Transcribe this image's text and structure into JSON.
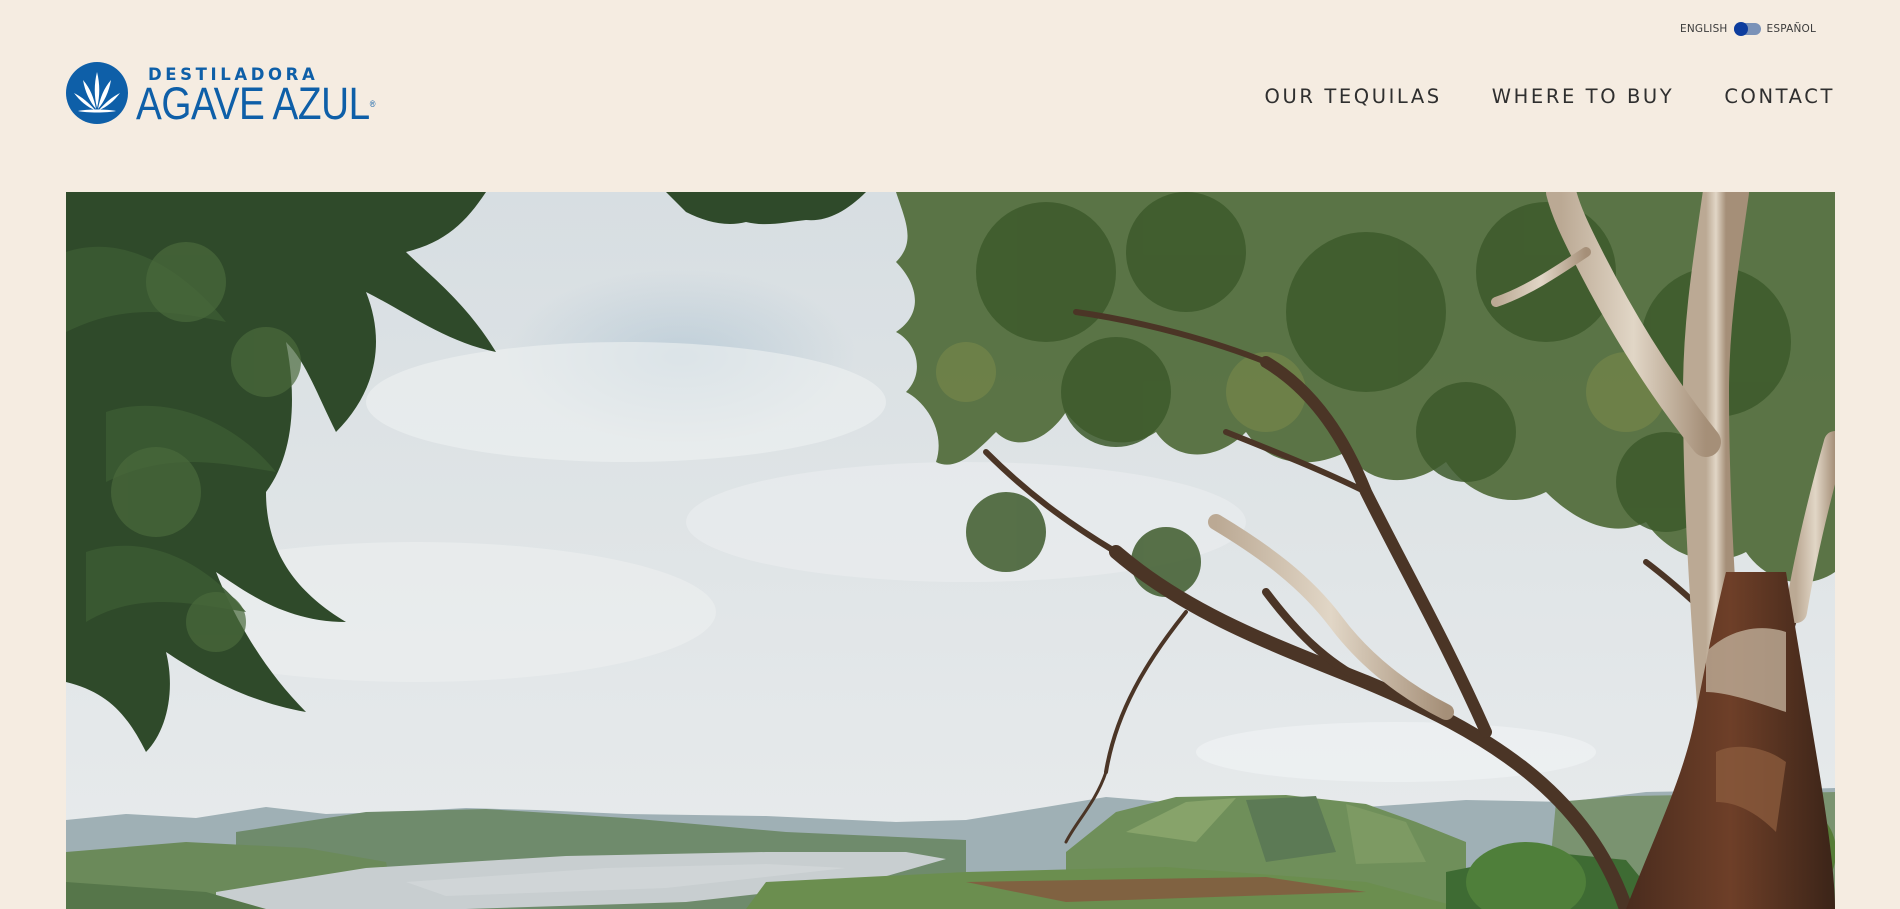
{
  "language": {
    "left_label": "ENGLISH",
    "right_label": "ESPAÑOL",
    "selected": "ENGLISH"
  },
  "brand": {
    "top_line": "DESTILADORA",
    "main_line": "AGAVE AZUL",
    "registered_mark": "®",
    "color": "#0e5fa8"
  },
  "nav": {
    "items": [
      {
        "label": "OUR TEQUILAS"
      },
      {
        "label": "WHERE TO BUY"
      },
      {
        "label": "CONTACT"
      }
    ]
  },
  "hero": {
    "icon": "landscape-photo"
  },
  "colors": {
    "background": "#f5ece1",
    "toggle_knob": "#0d3d9e",
    "toggle_track": "#7a92b8"
  }
}
